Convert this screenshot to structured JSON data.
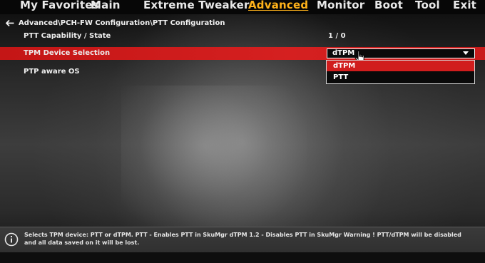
{
  "menu": {
    "tabs": [
      {
        "label": "My Favorites"
      },
      {
        "label": "Main"
      },
      {
        "label": "Extreme Tweaker"
      },
      {
        "label": "Advanced",
        "active": true
      },
      {
        "label": "Monitor"
      },
      {
        "label": "Boot"
      },
      {
        "label": "Tool"
      },
      {
        "label": "Exit"
      }
    ]
  },
  "breadcrumb": {
    "path": "Advanced\\PCH-FW Configuration\\PTT Configuration"
  },
  "settings": {
    "ptt_capability": {
      "label": "PTT Capability / State",
      "value": "1 / 0"
    },
    "tpm_device": {
      "label": "TPM Device Selection",
      "value": "dTPM"
    },
    "ptp_aware": {
      "label": "PTP aware OS"
    }
  },
  "dropdown": {
    "options": [
      "dTPM",
      "PTT"
    ],
    "selected": "dTPM"
  },
  "help": {
    "line1": "Selects TPM device: PTT or dTPM. PTT - Enables PTT in SkuMgr dTPM 1.2 - Disables PTT in SkuMgr Warning ! PTT/dTPM will be disabled",
    "line2": "and all data saved on it will be lost."
  },
  "colors": {
    "accent": "#ffb21a",
    "highlight": "#d11d1d",
    "background": "#2a2a2a"
  }
}
